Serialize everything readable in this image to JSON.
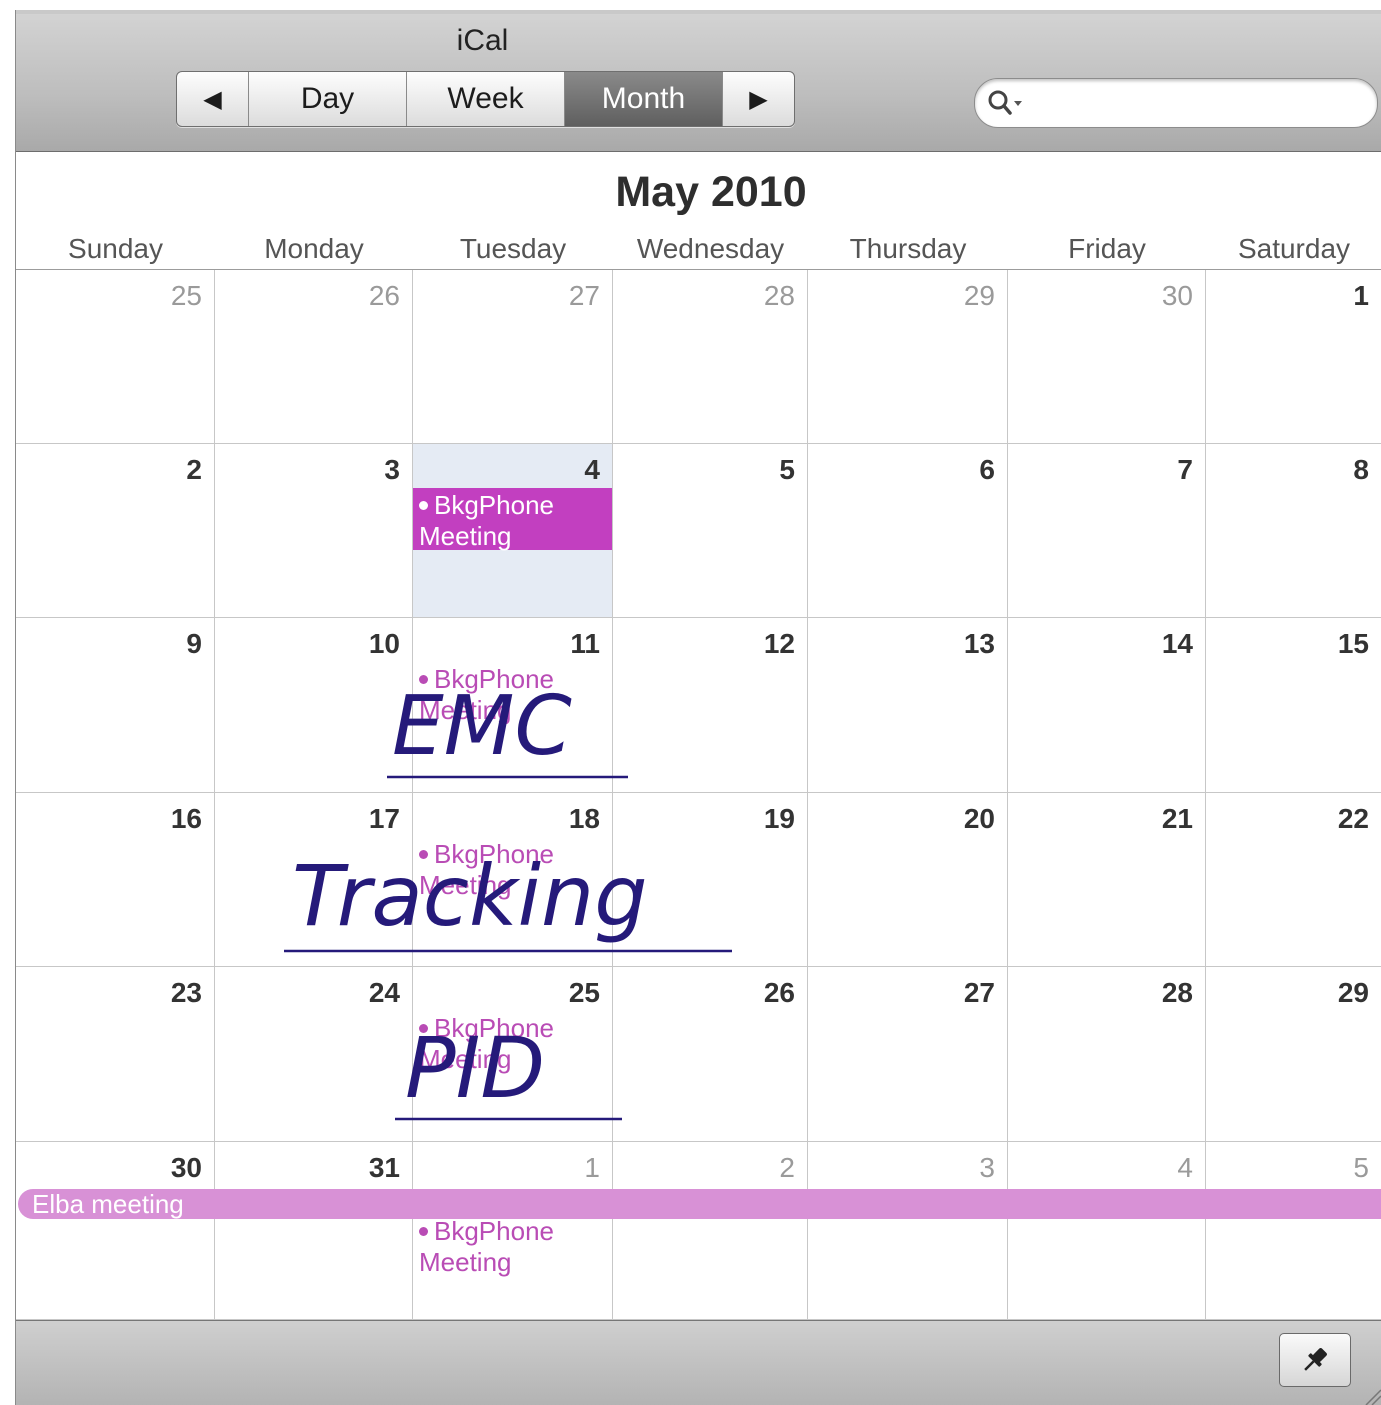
{
  "window": {
    "title": "iCal"
  },
  "toolbar": {
    "prev_label": "◀",
    "next_label": "▶",
    "views": [
      {
        "label": "Day",
        "selected": false
      },
      {
        "label": "Week",
        "selected": false
      },
      {
        "label": "Month",
        "selected": true
      }
    ],
    "search": {
      "value": "",
      "placeholder": "",
      "icon": "search-icon"
    }
  },
  "calendar": {
    "month_title": "May 2010",
    "weekdays": [
      "Sunday",
      "Monday",
      "Tuesday",
      "Wednesday",
      "Thursday",
      "Friday",
      "Saturday"
    ],
    "today": {
      "week": 1,
      "day": 2
    },
    "weeks": [
      {
        "days": [
          {
            "num": "25",
            "other": true
          },
          {
            "num": "26",
            "other": true
          },
          {
            "num": "27",
            "other": true
          },
          {
            "num": "28",
            "other": true
          },
          {
            "num": "29",
            "other": true
          },
          {
            "num": "30",
            "other": true
          },
          {
            "num": "1",
            "other": false
          }
        ]
      },
      {
        "days": [
          {
            "num": "2"
          },
          {
            "num": "3"
          },
          {
            "num": "4",
            "events": [
              {
                "title": "BkgPhone Meeting",
                "selected": true
              }
            ]
          },
          {
            "num": "5"
          },
          {
            "num": "6"
          },
          {
            "num": "7"
          },
          {
            "num": "8"
          }
        ]
      },
      {
        "days": [
          {
            "num": "9"
          },
          {
            "num": "10"
          },
          {
            "num": "11",
            "events": [
              {
                "title": "BkgPhone Meeting"
              }
            ]
          },
          {
            "num": "12"
          },
          {
            "num": "13"
          },
          {
            "num": "14"
          },
          {
            "num": "15"
          }
        ]
      },
      {
        "days": [
          {
            "num": "16"
          },
          {
            "num": "17"
          },
          {
            "num": "18",
            "events": [
              {
                "title": "BkgPhone Meeting"
              }
            ]
          },
          {
            "num": "19"
          },
          {
            "num": "20"
          },
          {
            "num": "21"
          },
          {
            "num": "22"
          }
        ]
      },
      {
        "days": [
          {
            "num": "23"
          },
          {
            "num": "24"
          },
          {
            "num": "25",
            "events": [
              {
                "title": "BkgPhone Meeting"
              }
            ]
          },
          {
            "num": "26"
          },
          {
            "num": "27"
          },
          {
            "num": "28"
          },
          {
            "num": "29"
          }
        ]
      },
      {
        "days": [
          {
            "num": "30"
          },
          {
            "num": "31"
          },
          {
            "num": "1",
            "other": true,
            "events": [
              {
                "title": "BkgPhone Meeting"
              }
            ]
          },
          {
            "num": "2",
            "other": true
          },
          {
            "num": "3",
            "other": true
          },
          {
            "num": "4",
            "other": true
          },
          {
            "num": "5",
            "other": true
          }
        ]
      }
    ],
    "allday_event": {
      "title": "Elba meeting",
      "week": 5
    },
    "event_color": "#c23fc0",
    "allday_color": "#d891d6",
    "today_color": "#e5ebf4"
  },
  "annotations": [
    {
      "text": "EMC"
    },
    {
      "text": "Tracking"
    },
    {
      "text": "PID"
    }
  ],
  "bottom_bar": {
    "pin_icon": "pushpin-icon"
  }
}
